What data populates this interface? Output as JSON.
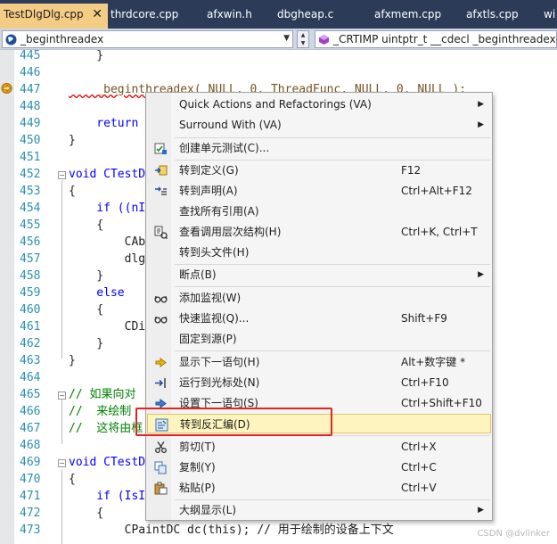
{
  "tabs": [
    {
      "label": "TestDlgDlg.cpp",
      "close": "✕"
    },
    {
      "label": "thrdcore.cpp"
    },
    {
      "label": "afxwin.h"
    },
    {
      "label": "dbgheap.c"
    },
    {
      "label": "afxmem.cpp"
    },
    {
      "label": "afxtls.cpp"
    },
    {
      "label": "wi"
    }
  ],
  "nav": {
    "left_value": "_beginthreadex",
    "right_value": "_CRTIMP uintptr_t __cdecl _beginthreadex(_"
  },
  "lines": [
    {
      "n": "445",
      "code": "    }"
    },
    {
      "n": "446",
      "code": ""
    },
    {
      "n": "447",
      "code": "    _beginthreadex( NULL, 0, ThreadFunc, NULL, 0, NULL );"
    },
    {
      "n": "448",
      "code": ""
    },
    {
      "n": "449",
      "code": "    return"
    },
    {
      "n": "450",
      "code": "}"
    },
    {
      "n": "451",
      "code": ""
    },
    {
      "n": "452",
      "code": "void CTestD"
    },
    {
      "n": "453",
      "code": "{"
    },
    {
      "n": "454",
      "code": "    if ((nI"
    },
    {
      "n": "455",
      "code": "    {"
    },
    {
      "n": "456",
      "code": "        CAb"
    },
    {
      "n": "457",
      "code": "        dlg"
    },
    {
      "n": "458",
      "code": "    }"
    },
    {
      "n": "459",
      "code": "    else"
    },
    {
      "n": "460",
      "code": "    {"
    },
    {
      "n": "461",
      "code": "        CDi"
    },
    {
      "n": "462",
      "code": "    }"
    },
    {
      "n": "463",
      "code": "}"
    },
    {
      "n": "464",
      "code": ""
    },
    {
      "n": "465",
      "code": "// 如果向对"
    },
    {
      "n": "466",
      "code": "//  来绘制"
    },
    {
      "n": "467",
      "code": "//  这将由框"
    },
    {
      "n": "468",
      "code": ""
    },
    {
      "n": "469",
      "code": "void CTestD"
    },
    {
      "n": "470",
      "code": "{"
    },
    {
      "n": "471",
      "code": "    if (IsI"
    },
    {
      "n": "472",
      "code": "    {"
    },
    {
      "n": "473",
      "code": "        CPaintDC dc(this); // 用于绘制的设备上下文"
    }
  ],
  "menu": {
    "items": [
      {
        "label": "Quick Actions and Refactorings (VA)",
        "shortcut": "",
        "submenu": true,
        "icon": ""
      },
      {
        "label": "Surround With (VA)",
        "shortcut": "",
        "submenu": true,
        "icon": ""
      },
      {
        "label": "创建单元测试(C)...",
        "shortcut": "",
        "submenu": false,
        "icon": "unit-test-icon"
      },
      {
        "label": "转到定义(G)",
        "shortcut": "F12",
        "submenu": false,
        "icon": "go-to-definition-icon"
      },
      {
        "label": "转到声明(A)",
        "shortcut": "Ctrl+Alt+F12",
        "submenu": false,
        "icon": "go-to-declaration-icon"
      },
      {
        "label": "查找所有引用(A)",
        "shortcut": "",
        "submenu": false,
        "icon": ""
      },
      {
        "label": "查看调用层次结构(H)",
        "shortcut": "Ctrl+K, Ctrl+T",
        "submenu": false,
        "icon": "call-hierarchy-icon"
      },
      {
        "label": "转到头文件(H)",
        "shortcut": "",
        "submenu": false,
        "icon": ""
      },
      {
        "label": "断点(B)",
        "shortcut": "",
        "submenu": true,
        "icon": ""
      },
      {
        "label": "添加监视(W)",
        "shortcut": "",
        "submenu": false,
        "icon": "glasses-icon"
      },
      {
        "label": "快速监视(Q)...",
        "shortcut": "Shift+F9",
        "submenu": false,
        "icon": "glasses-icon"
      },
      {
        "label": "固定到源(P)",
        "shortcut": "",
        "submenu": false,
        "icon": ""
      },
      {
        "label": "显示下一语句(H)",
        "shortcut": "Alt+数字键 *",
        "submenu": false,
        "icon": "show-next-statement-icon"
      },
      {
        "label": "运行到光标处(N)",
        "shortcut": "Ctrl+F10",
        "submenu": false,
        "icon": "run-to-cursor-icon"
      },
      {
        "label": "设置下一语句(S)",
        "shortcut": "Ctrl+Shift+F10",
        "submenu": false,
        "icon": "set-next-statement-icon"
      },
      {
        "label": "转到反汇编(D)",
        "shortcut": "",
        "submenu": false,
        "icon": "disassembly-icon",
        "highlighted": true
      },
      {
        "label": "剪切(T)",
        "shortcut": "Ctrl+X",
        "submenu": false,
        "icon": "scissors-icon"
      },
      {
        "label": "复制(Y)",
        "shortcut": "Ctrl+C",
        "submenu": false,
        "icon": "copy-icon"
      },
      {
        "label": "粘贴(P)",
        "shortcut": "Ctrl+V",
        "submenu": false,
        "icon": "paste-icon"
      },
      {
        "label": "大纲显示(L)",
        "shortcut": "",
        "submenu": true,
        "icon": ""
      }
    ]
  },
  "watermark": "CSDN @dvlinker",
  "colors": {
    "accent_tab": "#f5cc84",
    "highlight": "#fdf4bf",
    "annotation_box": "#e0261e",
    "tabbar": "#2c3c58"
  }
}
